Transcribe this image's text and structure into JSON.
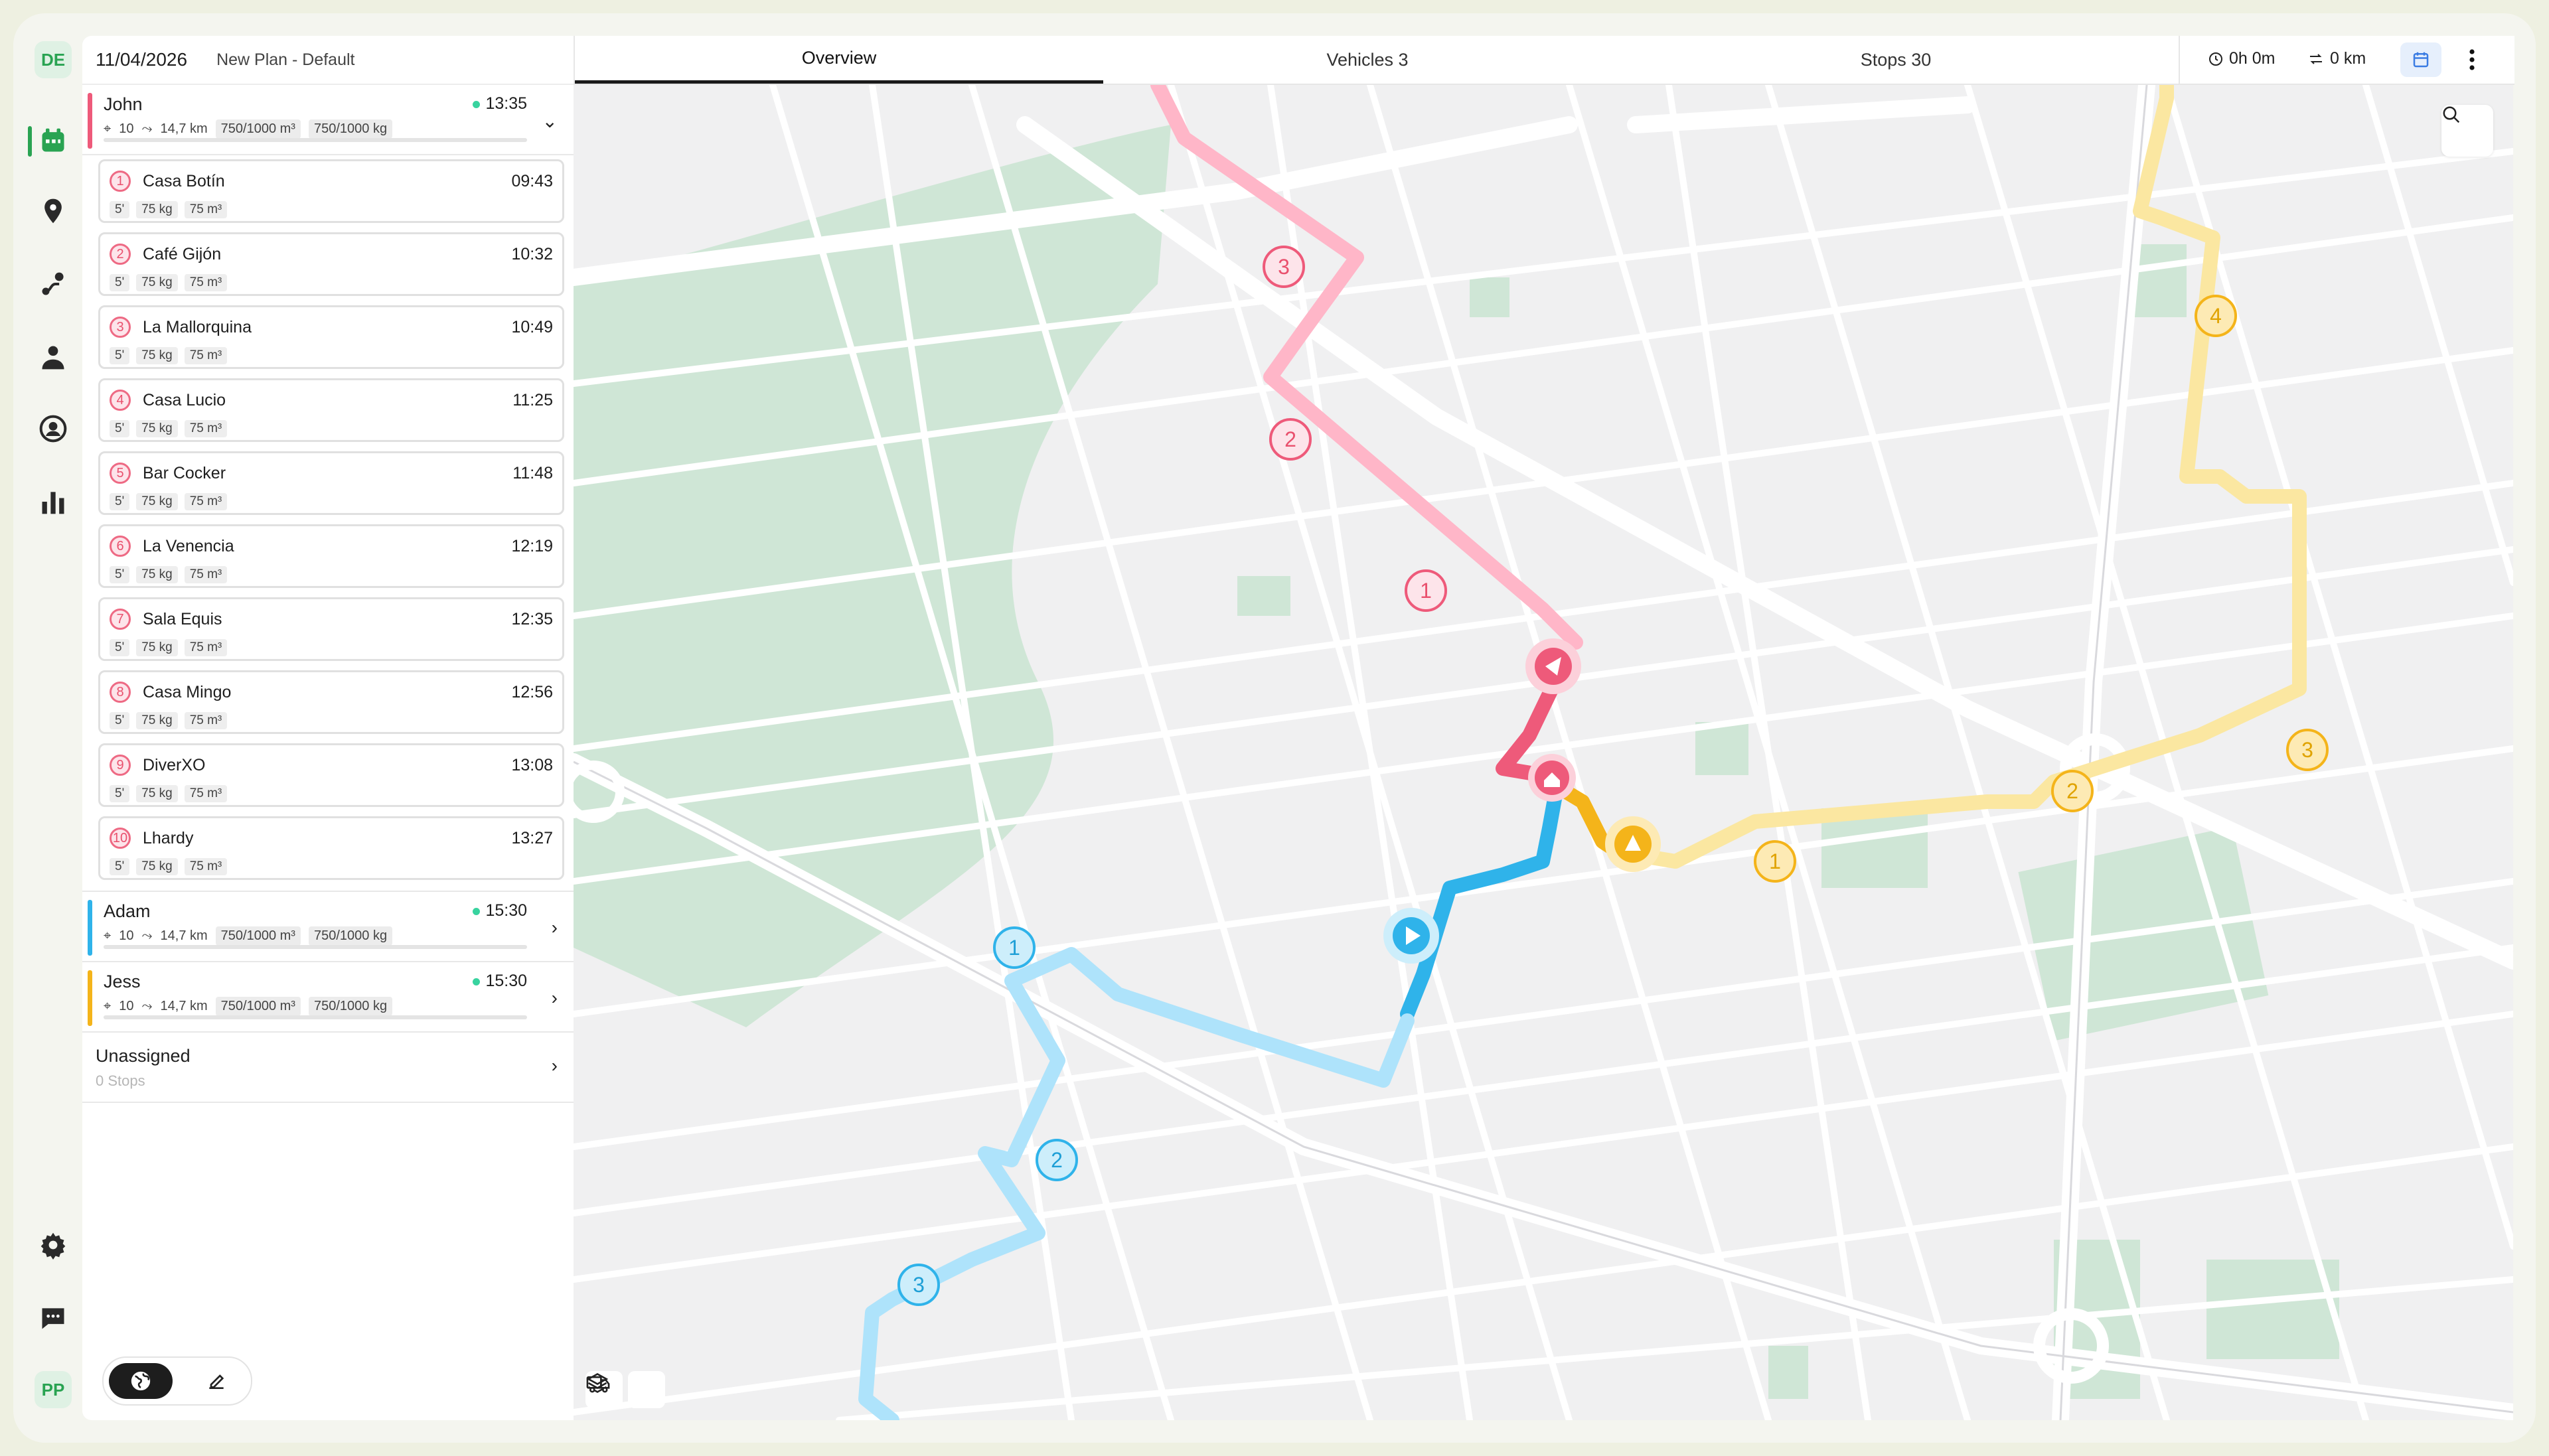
{
  "rail": {
    "top_badge": "DE",
    "bottom_badge": "PP",
    "icons": [
      "calendar-icon",
      "map-pin-icon",
      "route-icon",
      "driver-icon",
      "user-circle-icon",
      "bar-chart-icon",
      "gear-icon",
      "chat-icon"
    ]
  },
  "panel": {
    "date": "11/04/2026",
    "plan": "New Plan - Default"
  },
  "vehicles": [
    {
      "name": "John",
      "time": "13:35",
      "stops": "10",
      "distance": "14,7 km",
      "volume": "750/1000 m³",
      "weight": "750/1000 kg",
      "color": "#ee5a7a",
      "expanded": true
    },
    {
      "name": "Adam",
      "time": "15:30",
      "stops": "10",
      "distance": "14,7 km",
      "volume": "750/1000 m³",
      "weight": "750/1000 kg",
      "color": "#2fb3ea",
      "expanded": false
    },
    {
      "name": "Jess",
      "time": "15:30",
      "stops": "10",
      "distance": "14,7 km",
      "volume": "750/1000 m³",
      "weight": "750/1000 kg",
      "color": "#f4b41a",
      "expanded": false
    }
  ],
  "stops": [
    {
      "n": "1",
      "name": "Casa Botín",
      "time": "09:43",
      "dur": "5'",
      "kg": "75 kg",
      "vol": "75 m³"
    },
    {
      "n": "2",
      "name": "Café Gijón",
      "time": "10:32",
      "dur": "5'",
      "kg": "75 kg",
      "vol": "75 m³"
    },
    {
      "n": "3",
      "name": "La Mallorquina",
      "time": "10:49",
      "dur": "5'",
      "kg": "75 kg",
      "vol": "75 m³"
    },
    {
      "n": "4",
      "name": "Casa Lucio",
      "time": "11:25",
      "dur": "5'",
      "kg": "75 kg",
      "vol": "75 m³"
    },
    {
      "n": "5",
      "name": "Bar Cocker",
      "time": "11:48",
      "dur": "5'",
      "kg": "75 kg",
      "vol": "75 m³"
    },
    {
      "n": "6",
      "name": "La Venencia",
      "time": "12:19",
      "dur": "5'",
      "kg": "75 kg",
      "vol": "75 m³"
    },
    {
      "n": "7",
      "name": "Sala Equis",
      "time": "12:35",
      "dur": "5'",
      "kg": "75 kg",
      "vol": "75 m³"
    },
    {
      "n": "8",
      "name": "Casa Mingo",
      "time": "12:56",
      "dur": "5'",
      "kg": "75 kg",
      "vol": "75 m³"
    },
    {
      "n": "9",
      "name": "DiverXO",
      "time": "13:08",
      "dur": "5'",
      "kg": "75 kg",
      "vol": "75 m³"
    },
    {
      "n": "10",
      "name": "Lhardy",
      "time": "13:27",
      "dur": "5'",
      "kg": "75 kg",
      "vol": "75 m³"
    }
  ],
  "unassigned": {
    "label": "Unassigned",
    "sub": "0 Stops"
  },
  "tabs": [
    {
      "label": "Overview",
      "active": true
    },
    {
      "label": "Vehicles 3",
      "active": false
    },
    {
      "label": "Stops 30",
      "active": false
    }
  ],
  "stats": {
    "duration": "0h 0m",
    "distance": "0 km"
  },
  "map": {
    "route_colors": {
      "pink": "#ffb6c8",
      "pink_dark": "#ee5a7a",
      "blue": "#aee3fb",
      "blue_dark": "#2fb3ea",
      "yellow": "#fbe7a1",
      "yellow_dark": "#f4b41a"
    },
    "markers": {
      "pink": [
        "1",
        "2",
        "3"
      ],
      "blue": [
        "1",
        "2",
        "3"
      ],
      "yellow": [
        "1",
        "2",
        "3",
        "4"
      ]
    }
  }
}
